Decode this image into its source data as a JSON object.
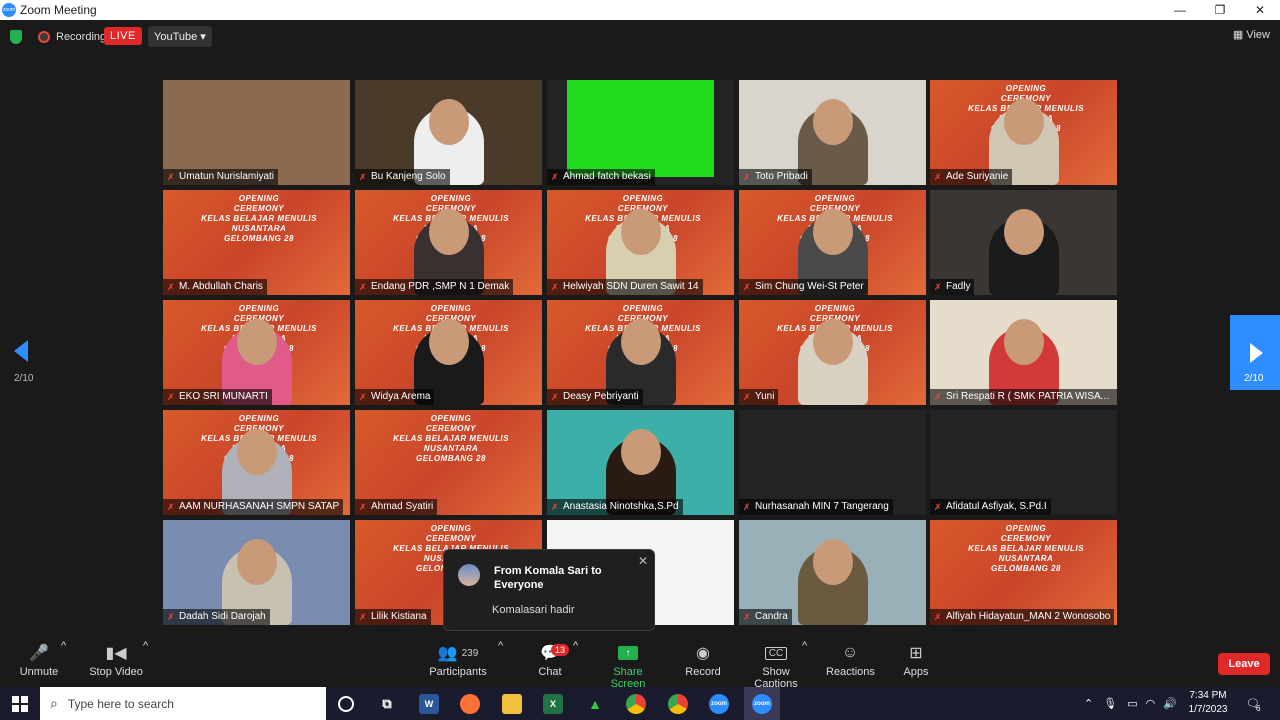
{
  "window": {
    "title": "Zoom Meeting",
    "minimize": "—",
    "maximize": "❐",
    "close": "✕"
  },
  "topbar": {
    "recording": "Recording",
    "live": "LIVE",
    "stream": "YouTube ▾",
    "view": "View"
  },
  "nav": {
    "left_page": "2/10",
    "right_page": "2/10"
  },
  "participants": [
    {
      "name": "Umatun Nurislamiyati"
    },
    {
      "name": "Bu Kanjeng Solo"
    },
    {
      "name": "Ahmad fatch bekasi"
    },
    {
      "name": "Toto Pribadi"
    },
    {
      "name": "Ade Suriyanie"
    },
    {
      "name": "M. Abdullah Charis"
    },
    {
      "name": "Endang PDR ,SMP N 1 Demak"
    },
    {
      "name": "Helwiyah SDN Duren Sawit 14"
    },
    {
      "name": "Sim Chung Wei-St Peter"
    },
    {
      "name": "Fadly"
    },
    {
      "name": "EKO SRI MUNARTI"
    },
    {
      "name": "Widya Arema"
    },
    {
      "name": "Deasy Pebriyanti"
    },
    {
      "name": "Yuni"
    },
    {
      "name": "Sri Respati R ( SMK PATRIA WISATA )"
    },
    {
      "name": "AAM NURHASANAH SMPN SATAP"
    },
    {
      "name": "Ahmad Syatiri"
    },
    {
      "name": "Anastasia Ninotshka,S.Pd"
    },
    {
      "name": "Nurhasanah MIN 7 Tangerang"
    },
    {
      "name": "Afidatul Asfiyak, S.Pd.I"
    },
    {
      "name": "Dadah Sidi Darojah"
    },
    {
      "name": "Lilik Kistiana"
    },
    {
      "name": ""
    },
    {
      "name": "Candra"
    },
    {
      "name": "Alfiyah Hidayatun_MAN 2 Wonosobo"
    }
  ],
  "poster": {
    "line1": "OPENING",
    "line2": "CEREMONY",
    "line3": "KELAS BELAJAR MENULIS",
    "line4": "NUSANTARA",
    "line5": "GELOMBANG 28"
  },
  "chat_popup": {
    "from": "From Komala Sari to Everyone",
    "message": "Komalasari hadir",
    "close": "✕"
  },
  "toolbar": {
    "unmute": "Unmute",
    "stop_video": "Stop Video",
    "participants": "Participants",
    "participant_count": "239",
    "chat": "Chat",
    "chat_badge": "13",
    "share": "Share Screen",
    "record": "Record",
    "captions": "Show Captions",
    "reactions": "Reactions",
    "apps": "Apps",
    "leave": "Leave"
  },
  "taskbar": {
    "search_placeholder": "Type here to search",
    "time": "7:34 PM",
    "date": "1/7/2023",
    "notif_count": "6"
  },
  "colors": {
    "accent": "#2d8cff",
    "live": "#e02828",
    "share": "#23b14d"
  }
}
